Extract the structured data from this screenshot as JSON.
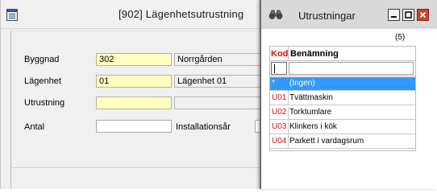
{
  "main_window": {
    "title": "[902]  Lägenhetsutrustning",
    "fields": {
      "byggnad": {
        "label": "Byggnad",
        "value": "302",
        "description": "Norrgården"
      },
      "lagenhet": {
        "label": "Lägenhet",
        "value": "01",
        "description": "Lägenhet 01"
      },
      "utrustning": {
        "label": "Utrustning",
        "value": "",
        "description": ""
      },
      "antal": {
        "label": "Antal",
        "value": ""
      },
      "installationsar": {
        "label": "Installationsår",
        "value": ""
      }
    }
  },
  "popup": {
    "title": "Utrustningar",
    "count": "(5)",
    "columns": {
      "kod": "Kod",
      "benamning": "Benämning"
    },
    "filter": {
      "kod": "",
      "benamning": ""
    },
    "rows": [
      {
        "kod": "*",
        "benamning": "(Ingen)",
        "selected": true
      },
      {
        "kod": "U01",
        "benamning": "Tvättmaskin",
        "selected": false
      },
      {
        "kod": "U02",
        "benamning": "Torktumlare",
        "selected": false
      },
      {
        "kod": "U03",
        "benamning": "Klinkers i kök",
        "selected": false
      },
      {
        "kod": "U04",
        "benamning": "Parkett i vardagsrum",
        "selected": false
      }
    ],
    "colors": {
      "selected_row": "#3399ff",
      "code_text": "#d01010",
      "close_button": "#c9422f"
    }
  },
  "icons": {
    "main_window_icon": "document-icon",
    "popup_icon": "binoculars-icon",
    "minimize": "minimize-icon",
    "maximize": "maximize-icon",
    "close": "close-icon"
  }
}
